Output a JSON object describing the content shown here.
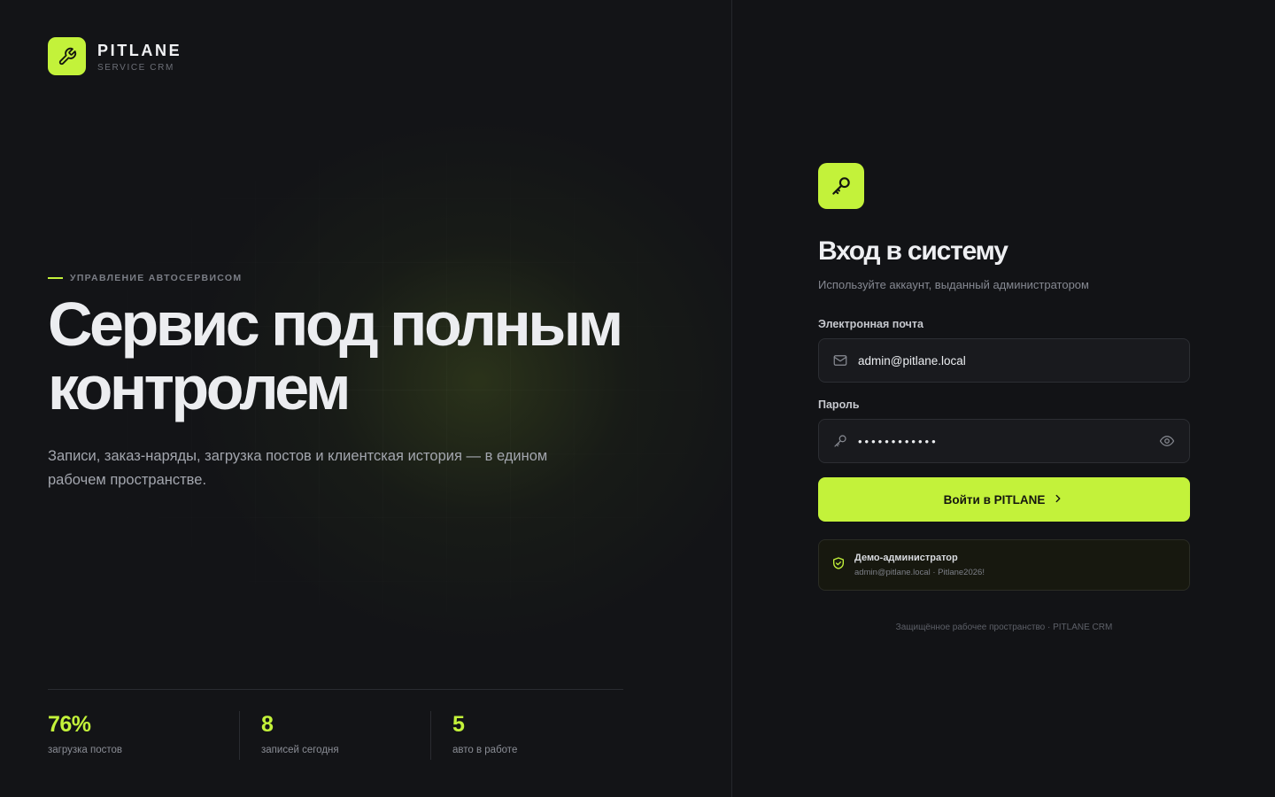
{
  "brand": {
    "name": "PITLANE",
    "subtitle": "SERVICE CRM"
  },
  "hero": {
    "eyebrow": "УПРАВЛЕНИЕ АВТОСЕРВИСОМ",
    "title_line1": "Сервис под полным",
    "title_line2": "контролем",
    "description": "Записи, заказ-наряды, загрузка постов и клиентская история — в едином рабочем пространстве."
  },
  "stats": [
    {
      "value": "76%",
      "label": "загрузка постов"
    },
    {
      "value": "8",
      "label": "записей сегодня"
    },
    {
      "value": "5",
      "label": "авто в работе"
    }
  ],
  "login": {
    "title": "Вход в систему",
    "subtitle": "Используйте аккаунт, выданный администратором",
    "email_label": "Электронная почта",
    "email_value": "admin@pitlane.local",
    "password_label": "Пароль",
    "password_value": "••••••••••••",
    "submit_label": "Войти в PITLANE"
  },
  "demo": {
    "title": "Демо-администратор",
    "credentials": "admin@pitlane.local · Pitlane2026!"
  },
  "footer": "Защищённое рабочее пространство · PITLANE CRM",
  "colors": {
    "accent": "#c3f23a",
    "background": "#121316"
  },
  "icons": [
    "wrench-icon",
    "key-icon",
    "mail-icon",
    "key-icon",
    "eye-icon",
    "chevron-right-icon",
    "shield-check-icon"
  ]
}
